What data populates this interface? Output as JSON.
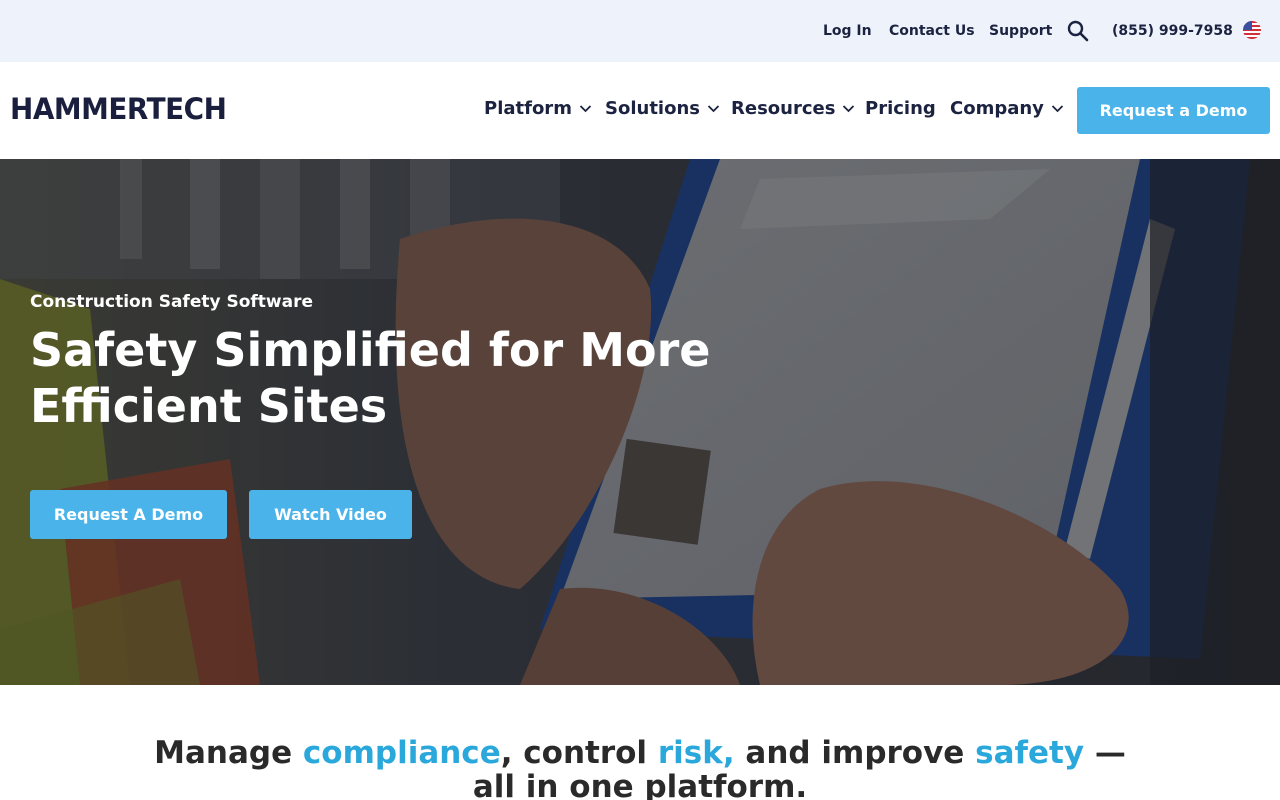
{
  "utility_bar": {
    "login": "Log In",
    "contact": "Contact Us",
    "support": "Support",
    "search_icon": "search-icon",
    "phone": "(855) 999-7958",
    "flag_icon": "us-flag-icon"
  },
  "header": {
    "logo": "HAMMERTECH",
    "nav": [
      {
        "label": "Platform",
        "dropdown": true
      },
      {
        "label": "Solutions",
        "dropdown": true
      },
      {
        "label": "Resources",
        "dropdown": true
      },
      {
        "label": "Pricing",
        "dropdown": false
      },
      {
        "label": "Company",
        "dropdown": true
      }
    ],
    "cta": "Request a Demo"
  },
  "hero": {
    "eyebrow": "Construction Safety Software",
    "title": "Safety Simplified for More Efficient Sites",
    "primary_button": "Request A Demo",
    "secondary_button": "Watch Video"
  },
  "tagline": {
    "parts": [
      "Manage ",
      "compliance",
      ", control ",
      "risk,",
      " and improve ",
      "safety",
      " —",
      "all in one platform."
    ]
  },
  "colors": {
    "accent": "#4ab4ea",
    "highlight": "#2aa8dc",
    "navy": "#1c2340",
    "utility_bg": "#eef3fb"
  }
}
